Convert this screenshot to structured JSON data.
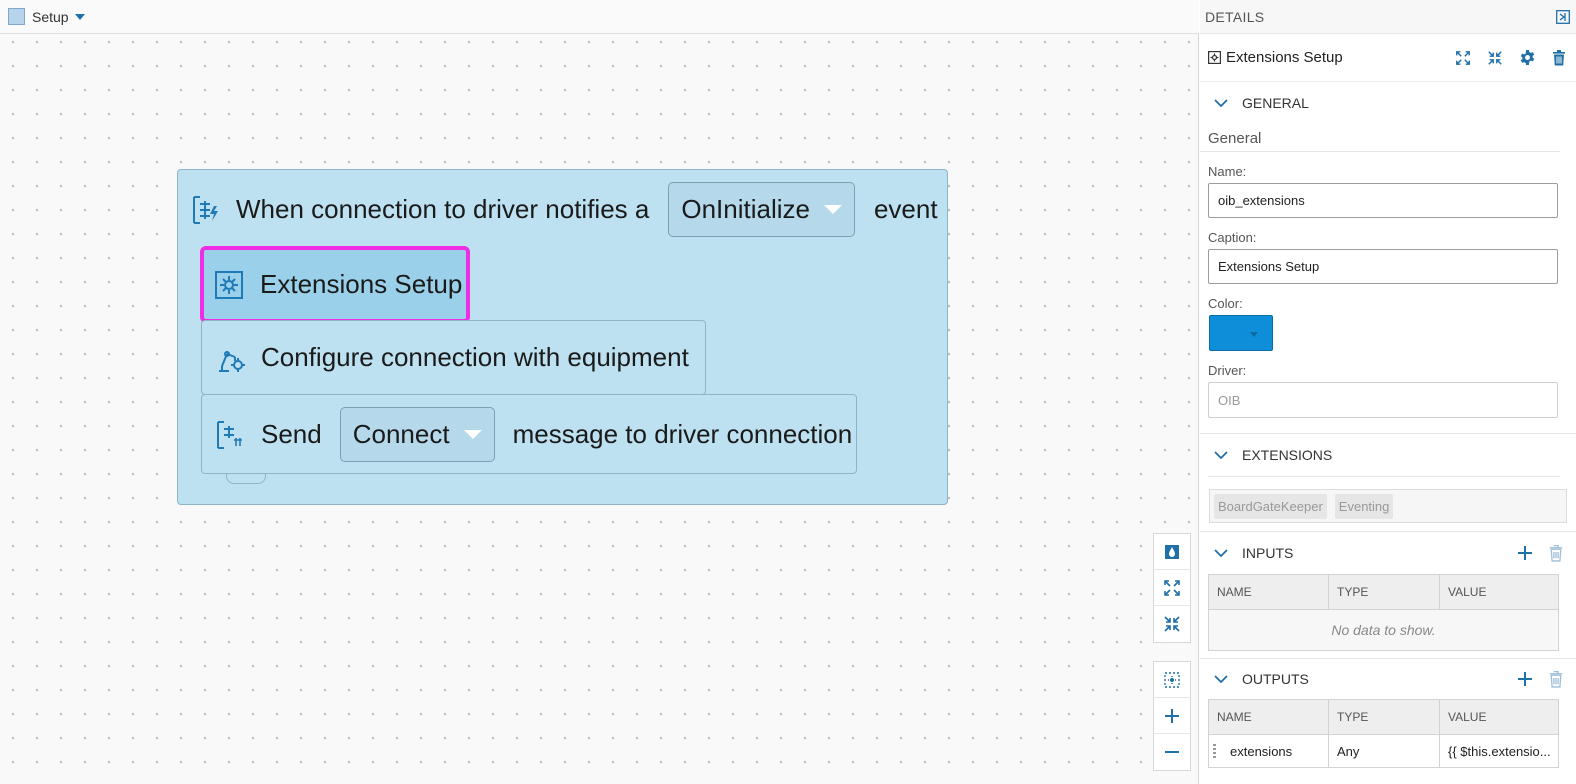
{
  "canvas": {
    "toolbar": {
      "label": "Setup"
    },
    "event_block": {
      "prefix": "When connection to driver notifies a",
      "event_value": "OnInitialize",
      "suffix": "event"
    },
    "extensions_block": {
      "label": "Extensions Setup"
    },
    "config_block": {
      "label": "Configure connection with equipment"
    },
    "send_block": {
      "prefix": "Send",
      "message_value": "Connect",
      "suffix": "message to driver connection"
    },
    "controls": [
      "color-drop-icon",
      "expand-icon",
      "collapse-icon",
      "fit-icon",
      "zoom-in-icon",
      "zoom-out-icon"
    ]
  },
  "details": {
    "title": "DETAILS",
    "object_title": "Extensions Setup",
    "general": {
      "section_label": "GENERAL",
      "subheading": "General",
      "name_label": "Name:",
      "name_value": "oib_extensions",
      "caption_label": "Caption:",
      "caption_value": "Extensions Setup",
      "color_label": "Color:",
      "color_value": "#0e8ed8",
      "driver_label": "Driver:",
      "driver_placeholder": "OIB"
    },
    "extensions": {
      "section_label": "EXTENSIONS",
      "items": [
        "BoardGateKeeper",
        "Eventing"
      ]
    },
    "inputs": {
      "section_label": "INPUTS",
      "columns": [
        "NAME",
        "TYPE",
        "VALUE"
      ],
      "empty_text": "No data to show."
    },
    "outputs": {
      "section_label": "OUTPUTS",
      "columns": [
        "NAME",
        "TYPE",
        "VALUE"
      ],
      "rows": [
        {
          "name": "extensions",
          "type": "Any",
          "value": "{{ $this.extensio..."
        }
      ]
    }
  }
}
